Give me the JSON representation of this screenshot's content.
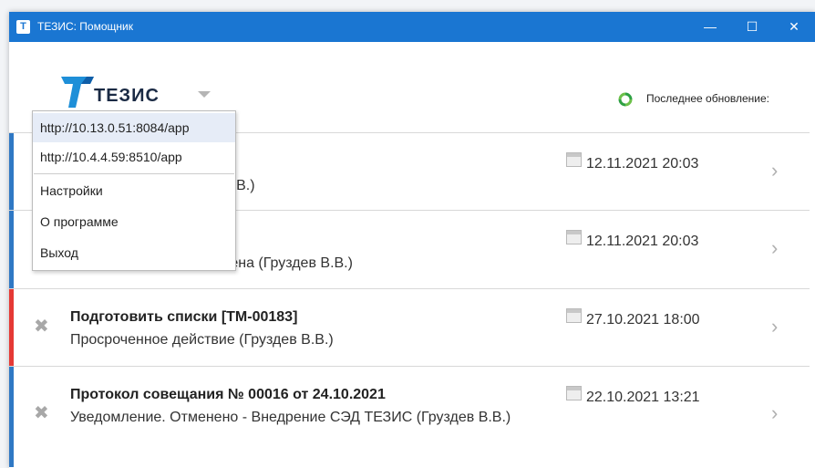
{
  "window": {
    "title": "ТЕЗИС: Помощник",
    "icon_glyph": "T"
  },
  "header": {
    "logo_text": "ТЕЗИС",
    "last_update_label": "Последнее обновление:"
  },
  "dropdown": {
    "items": [
      {
        "label": "http://10.13.0.51:8084/app"
      },
      {
        "label": "http://10.4.4.59:8510/app"
      },
      {
        "label": "Настройки"
      },
      {
        "label": "О программе"
      },
      {
        "label": "Выход"
      }
    ]
  },
  "notifications": [
    {
      "title": "",
      "subtitle": "В.В.)",
      "date": "12.11.2021 20:03",
      "stripe_color": "#2f78c4"
    },
    {
      "title": "",
      "subtitle": "чена (Груздев В.В.)",
      "date": "12.11.2021 20:03",
      "stripe_color": "#2f78c4"
    },
    {
      "title": "Подготовить списки [ТМ-00183]",
      "subtitle": "Просроченное действие (Груздев В.В.)",
      "date": "27.10.2021 18:00",
      "stripe_color": "#e53935"
    },
    {
      "title": "Протокол совещания № 00016 от 24.10.2021",
      "subtitle": "Уведомление. Отменено - Внедрение СЭД ТЕЗИС (Груздев В.В.)",
      "date": "22.10.2021 13:21",
      "stripe_color": "#2f78c4"
    }
  ],
  "icons": {
    "close": "close-icon",
    "chevron": "chevron-right-icon",
    "calendar": "calendar-icon",
    "refresh": "refresh-icon"
  }
}
